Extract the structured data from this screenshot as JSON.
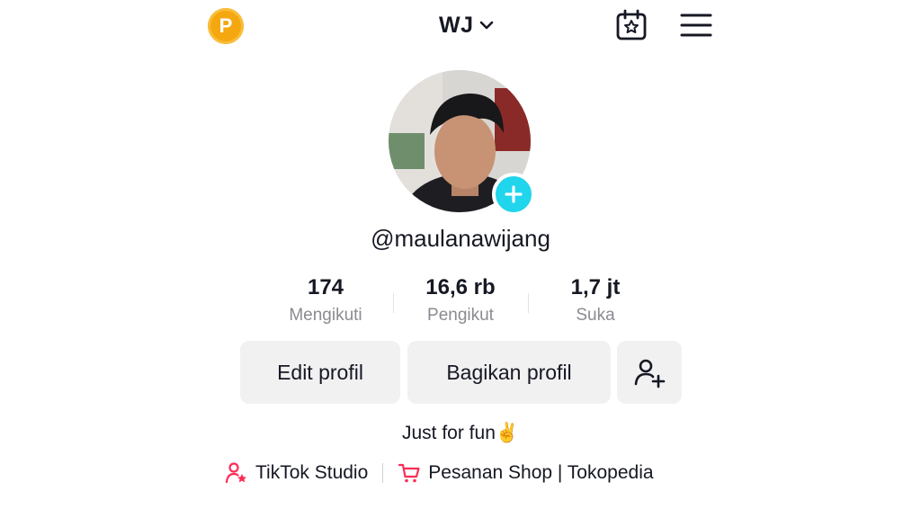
{
  "header": {
    "coin_label": "P",
    "title": "WJ",
    "icons": [
      "coin-icon",
      "chevron-down-icon",
      "calendar-star-icon",
      "hamburger-menu-icon"
    ]
  },
  "profile": {
    "username": "@maulanawijang"
  },
  "stats": [
    {
      "value": "174",
      "label": "Mengikuti"
    },
    {
      "value": "16,6 rb",
      "label": "Pengikut"
    },
    {
      "value": "1,7 jt",
      "label": "Suka"
    }
  ],
  "actions": {
    "edit_label": "Edit profil",
    "share_label": "Bagikan profil"
  },
  "bio": {
    "text": "Just for fun✌️"
  },
  "links": {
    "studio_label": "TikTok Studio",
    "shop_label": "Pesanan Shop | Tokopedia"
  },
  "colors": {
    "accent_cyan": "#20d5ec",
    "coin": "#f5a70f",
    "link_icon": "#fe2c55"
  }
}
